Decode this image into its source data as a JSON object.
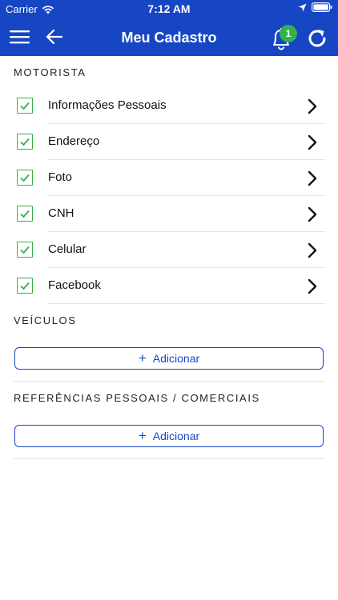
{
  "status_bar": {
    "carrier": "Carrier",
    "time": "7:12 AM"
  },
  "nav": {
    "title": "Meu Cadastro",
    "notification_count": "1",
    "icons": [
      "menu-icon",
      "back-arrow-icon",
      "bell-icon",
      "refresh-icon"
    ]
  },
  "sections": {
    "motorista": {
      "header": "MOTORISTA",
      "items": [
        {
          "label": "Informações Pessoais",
          "checked": true
        },
        {
          "label": "Endereço",
          "checked": true
        },
        {
          "label": "Foto",
          "checked": true
        },
        {
          "label": "CNH",
          "checked": true
        },
        {
          "label": "Celular",
          "checked": true
        },
        {
          "label": "Facebook",
          "checked": true
        }
      ]
    },
    "veiculos": {
      "header": "VEÍCULOS",
      "add_label": "Adicionar"
    },
    "referencias": {
      "header": "REFERÊNCIAS PESSOAIS / COMERCIAIS",
      "add_label": "Adicionar"
    }
  },
  "colors": {
    "primary": "#1746c4",
    "check": "#2fb34a",
    "badge": "#2fb34a"
  }
}
